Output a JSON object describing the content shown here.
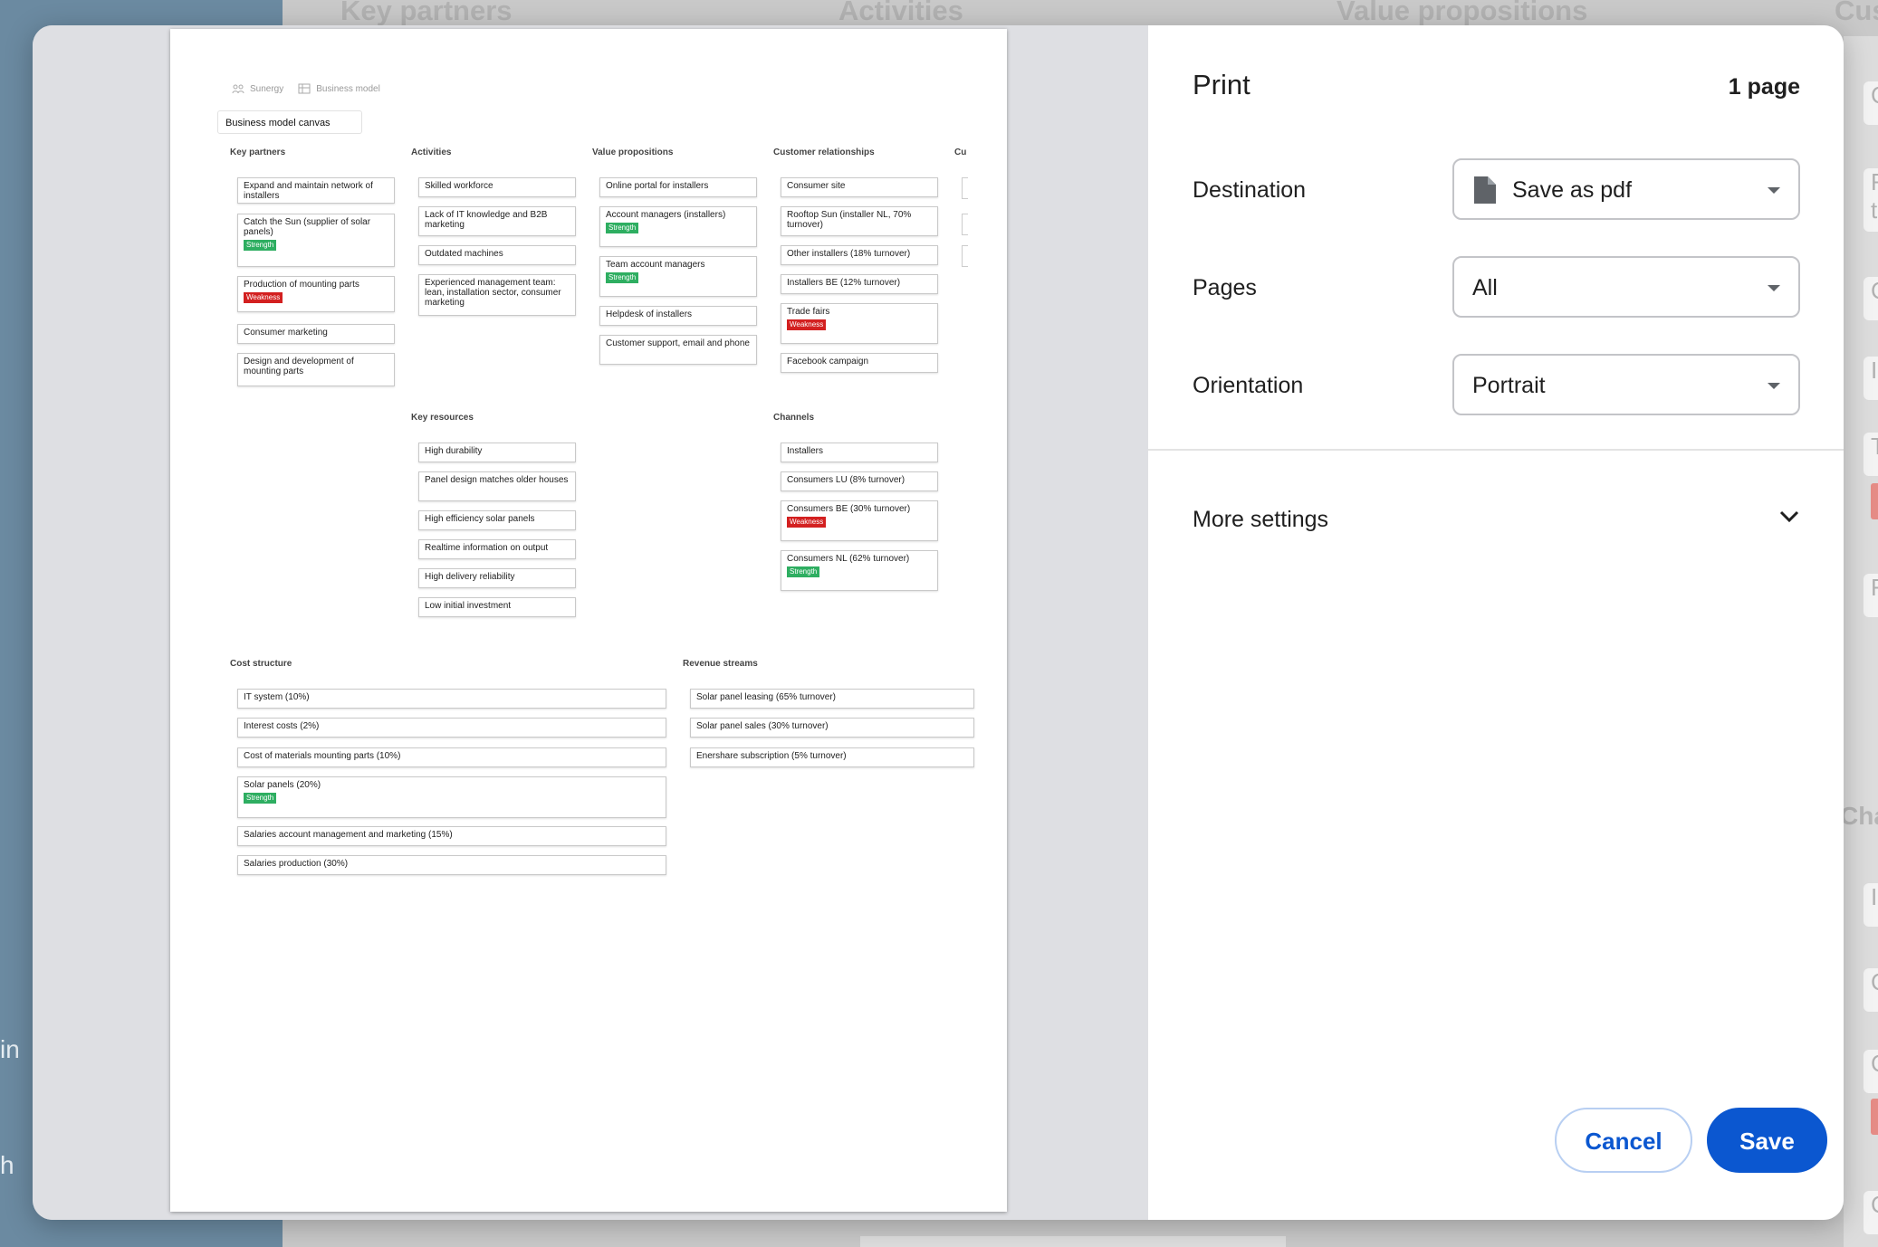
{
  "background": {
    "column_titles": [
      "Key partners",
      "Activities",
      "Value propositions",
      "Cus"
    ],
    "sidebar_fragments": [
      "in",
      "h"
    ],
    "right_fragments": [
      "C",
      "F",
      "t",
      "C",
      "I",
      "T",
      "F",
      "Cha",
      "I",
      "C",
      "C",
      "C"
    ]
  },
  "dialog": {
    "title": "Print",
    "page_count": "1 page",
    "destination": {
      "label": "Destination",
      "value": "Save as pdf"
    },
    "pages": {
      "label": "Pages",
      "value": "All"
    },
    "orientation": {
      "label": "Orientation",
      "value": "Portrait"
    },
    "more_settings": "More settings",
    "cancel": "Cancel",
    "save": "Save"
  },
  "preview": {
    "breadcrumb": [
      "Sunergy",
      "Business model"
    ],
    "tab": "Business model canvas",
    "sections": {
      "key_partners": {
        "title": "Key partners",
        "cards": [
          {
            "text": "Expand and maintain network of installers"
          },
          {
            "text": "Catch the Sun (supplier of solar panels)",
            "tag": "Strength"
          },
          {
            "text": "Production of mounting parts",
            "tag": "Weakness"
          },
          {
            "text": "Consumer marketing"
          },
          {
            "text": "Design and development of mounting parts"
          }
        ]
      },
      "activities": {
        "title": "Activities",
        "cards": [
          {
            "text": "Skilled workforce"
          },
          {
            "text": "Lack of IT knowledge and B2B marketing"
          },
          {
            "text": "Outdated machines"
          },
          {
            "text": "Experienced management team: lean, installation sector, consumer marketing"
          }
        ]
      },
      "value_propositions": {
        "title": "Value propositions",
        "cards": [
          {
            "text": "Online portal for installers"
          },
          {
            "text": "Account managers (installers)",
            "tag": "Strength"
          },
          {
            "text": "Team account managers",
            "tag": "Strength"
          },
          {
            "text": "Helpdesk of installers"
          },
          {
            "text": "Customer support, email and phone"
          }
        ]
      },
      "customer_relationships": {
        "title": "Customer relationships",
        "cards": [
          {
            "text": "Consumer site"
          },
          {
            "text": "Rooftop Sun (installer NL, 70% turnover)"
          },
          {
            "text": "Other installers (18% turnover)"
          },
          {
            "text": "Installers BE (12% turnover)"
          },
          {
            "text": "Trade fairs",
            "tag": "Weakness"
          },
          {
            "text": "Facebook campaign"
          }
        ]
      },
      "customer_segments": {
        "title": "Cu"
      },
      "key_resources": {
        "title": "Key resources",
        "cards": [
          {
            "text": "High durability"
          },
          {
            "text": "Panel design matches older houses"
          },
          {
            "text": "High efficiency solar panels"
          },
          {
            "text": "Realtime information on output"
          },
          {
            "text": "High delivery reliability"
          },
          {
            "text": "Low initial investment"
          }
        ]
      },
      "channels": {
        "title": "Channels",
        "cards": [
          {
            "text": "Installers"
          },
          {
            "text": "Consumers LU (8% turnover)"
          },
          {
            "text": "Consumers BE (30% turnover)",
            "tag": "Weakness"
          },
          {
            "text": "Consumers NL (62% turnover)",
            "tag": "Strength"
          }
        ]
      },
      "cost_structure": {
        "title": "Cost structure",
        "cards": [
          {
            "text": "IT system (10%)"
          },
          {
            "text": "Interest costs (2%)"
          },
          {
            "text": "Cost of materials mounting parts (10%)"
          },
          {
            "text": "Solar panels (20%)",
            "tag": "Strength"
          },
          {
            "text": "Salaries account management and marketing (15%)"
          },
          {
            "text": "Salaries production (30%)"
          }
        ]
      },
      "revenue_streams": {
        "title": "Revenue streams",
        "cards": [
          {
            "text": "Solar panel leasing (65% turnover)"
          },
          {
            "text": "Solar panel sales (30% turnover)"
          },
          {
            "text": "Enershare subscription (5% turnover)"
          }
        ]
      }
    }
  }
}
